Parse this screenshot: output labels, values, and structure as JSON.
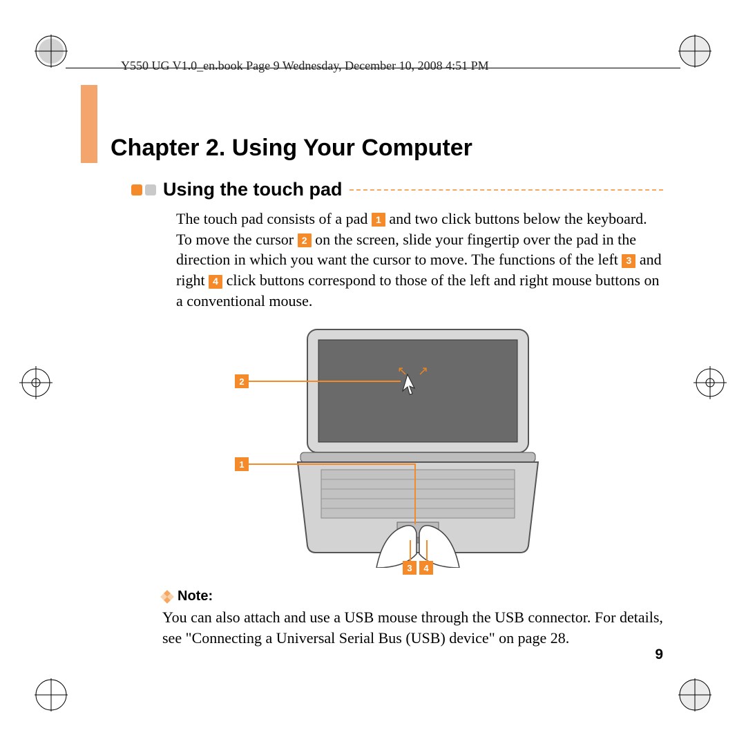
{
  "header": {
    "running": "Y550 UG V1.0_en.book  Page 9  Wednesday, December 10, 2008  4:51 PM"
  },
  "chapter": {
    "title": "Chapter 2. Using Your Computer"
  },
  "section": {
    "title": "Using the touch pad"
  },
  "body": {
    "p1_a": "The touch pad consists of a pad ",
    "c1": "1",
    "p1_b": " and two click buttons below the keyboard. To move the cursor ",
    "c2": "2",
    "p1_c": " on the screen, slide your fingertip over the pad in the direction in which you want the cursor to move. The functions of the left ",
    "c3": "3",
    "p1_d": " and right ",
    "c4": "4",
    "p1_e": " click buttons correspond to those of the left and right mouse buttons on a conventional mouse."
  },
  "figure": {
    "callouts": {
      "c1": "1",
      "c2": "2",
      "c3": "3",
      "c4": "4"
    },
    "alt": "Laptop with hands on touch pad, callouts 1–4 indicating pad, cursor, left click, right click"
  },
  "note": {
    "label": "Note:",
    "text": "You can also attach and use a USB mouse through the USB connector. For details, see \"Connecting a Universal Serial Bus (USB) device\" on page 28."
  },
  "page_number": "9"
}
